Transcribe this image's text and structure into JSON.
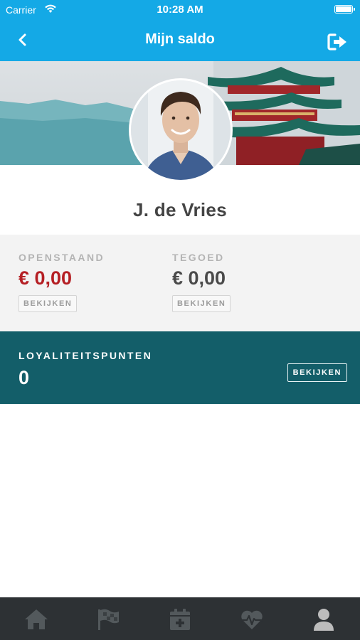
{
  "status_bar": {
    "carrier": "Carrier",
    "time": "10:28 AM"
  },
  "nav": {
    "title": "Mijn saldo",
    "back_icon": "chevron-left-icon",
    "logout_icon": "logout-icon"
  },
  "profile": {
    "name": "J. de Vries"
  },
  "balance": {
    "openstaand": {
      "label": "OPENSTAAND",
      "value": "€ 0,00",
      "button": "BEKIJKEN"
    },
    "tegoed": {
      "label": "TEGOED",
      "value": "€ 0,00",
      "button": "BEKIJKEN"
    }
  },
  "loyalty": {
    "label": "LOYALITEITSPUNTEN",
    "value": "0",
    "button": "BEKIJKEN"
  },
  "tabbar": {
    "tabs": [
      {
        "icon": "home-icon",
        "active": false
      },
      {
        "icon": "checkered-flag-icon",
        "active": false
      },
      {
        "icon": "calendar-plus-icon",
        "active": false
      },
      {
        "icon": "heartbeat-icon",
        "active": false
      },
      {
        "icon": "user-icon",
        "active": true
      }
    ]
  },
  "colors": {
    "header": "#14a9e6",
    "loyalty_panel": "#135e69",
    "tabbar": "#2d3134",
    "negative_value": "#b51f24",
    "tab_icon_active": "#bcbcbc",
    "tab_icon_inactive": "#53595c"
  }
}
